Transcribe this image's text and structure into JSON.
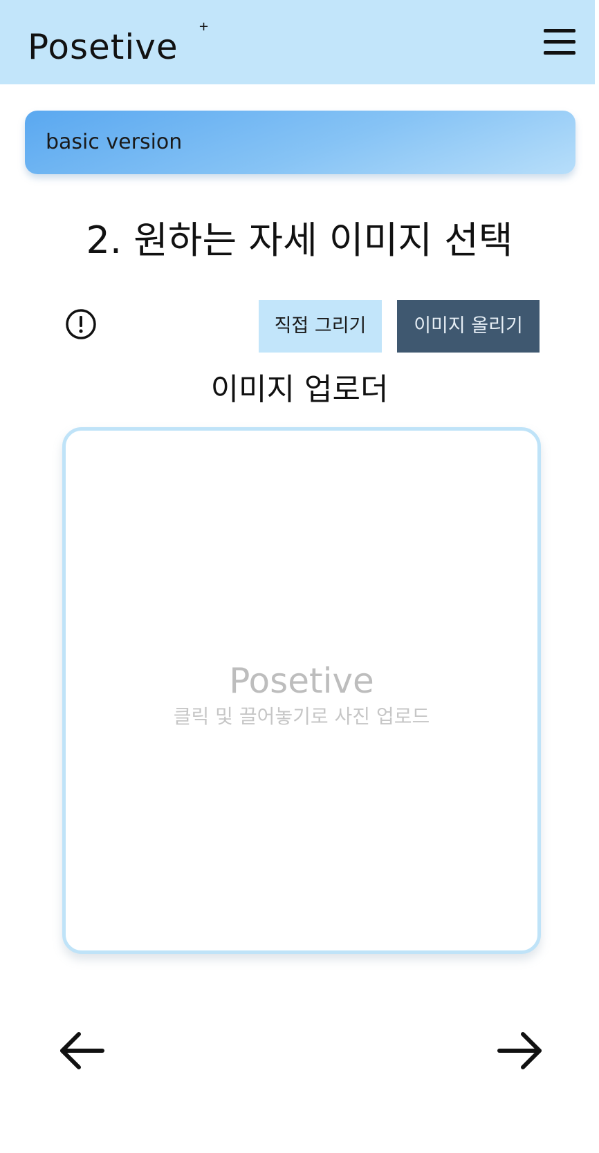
{
  "header": {
    "logo_text": "Posetive",
    "logo_star": "+",
    "menu_icon": "hamburger-menu-icon"
  },
  "banner": {
    "label": "basic version",
    "gradient_colors": [
      "#5aa8f0",
      "#b7defa"
    ]
  },
  "step": {
    "title": "2. 원하는 자세 이미지 선택"
  },
  "toolbar": {
    "info_icon": "info-circle-icon",
    "tabs": [
      {
        "label": "직접 그리기",
        "active": false,
        "color": "#c2e5fa"
      },
      {
        "label": "이미지 올리기",
        "active": true,
        "color": "#3f5870"
      }
    ]
  },
  "uploader": {
    "title": "이미지 업로더",
    "brand": "Posetive",
    "hint": "클릭 및 끌어놓기로 사진 업로드",
    "border_color": "#bfe3f8"
  },
  "navigation": {
    "prev_icon": "arrow-left-icon",
    "next_icon": "arrow-right-icon"
  },
  "colors": {
    "header_bg": "#c2e5fa",
    "accent_dark": "#3f5870"
  }
}
